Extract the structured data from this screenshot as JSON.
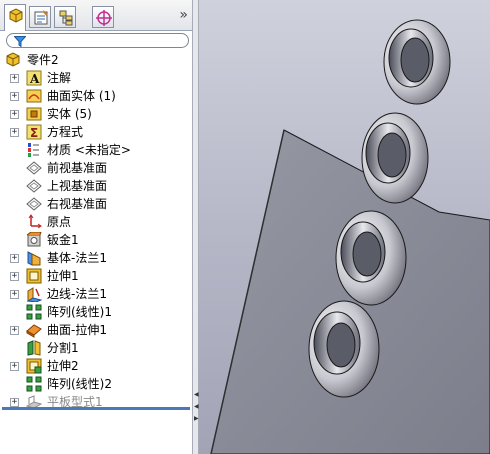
{
  "panel": {
    "tabs": [
      {
        "icon": "feature-manager-icon",
        "active": true
      },
      {
        "icon": "property-manager-icon",
        "active": false
      },
      {
        "icon": "configuration-manager-icon",
        "active": false
      },
      {
        "icon": "dimxpert-manager-icon",
        "active": false
      }
    ],
    "more_chevron": "»",
    "filter_icon": "filter-icon"
  },
  "tree": {
    "root_label": "零件2",
    "items": [
      {
        "label": "注解",
        "icon": "annotations-icon",
        "expandable": true
      },
      {
        "label": "曲面实体 (1)",
        "icon": "surface-bodies-icon",
        "expandable": true
      },
      {
        "label": "实体 (5)",
        "icon": "solid-bodies-icon",
        "expandable": true
      },
      {
        "label": "方程式",
        "icon": "equations-icon",
        "expandable": true
      },
      {
        "label": "材质 <未指定>",
        "icon": "material-icon",
        "expandable": false
      },
      {
        "label": "前视基准面",
        "icon": "plane-icon",
        "expandable": false
      },
      {
        "label": "上视基准面",
        "icon": "plane-icon",
        "expandable": false
      },
      {
        "label": "右视基准面",
        "icon": "plane-icon",
        "expandable": false
      },
      {
        "label": "原点",
        "icon": "origin-icon",
        "expandable": false
      },
      {
        "label": "钣金1",
        "icon": "sheet-metal-icon",
        "expandable": false
      },
      {
        "label": "基体-法兰1",
        "icon": "base-flange-icon",
        "expandable": true
      },
      {
        "label": "拉伸1",
        "icon": "extrude-icon",
        "expandable": true
      },
      {
        "label": "边线-法兰1",
        "icon": "edge-flange-icon",
        "expandable": true
      },
      {
        "label": "阵列(线性)1",
        "icon": "linear-pattern-icon",
        "expandable": false
      },
      {
        "label": "曲面-拉伸1",
        "icon": "surface-extrude-icon",
        "expandable": true
      },
      {
        "label": "分割1",
        "icon": "split-icon",
        "expandable": false
      },
      {
        "label": "拉伸2",
        "icon": "extrude-icon",
        "expandable": true
      },
      {
        "label": "阵列(线性)2",
        "icon": "linear-pattern-icon",
        "expandable": false
      },
      {
        "label": "平板型式1",
        "icon": "flat-pattern-icon",
        "expandable": true,
        "suppressed": true
      }
    ]
  },
  "colors": {
    "selection_bar": "#4a78b8",
    "viewport_top": "#cfd1dc",
    "viewport_bottom": "#a2a4b6",
    "part_face": "#8c8e9a",
    "suppressed_text": "#8a8a8a"
  }
}
